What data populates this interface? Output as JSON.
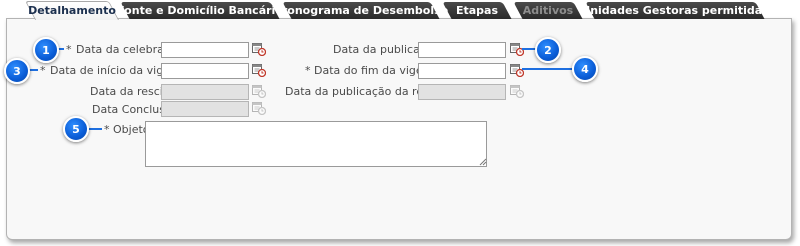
{
  "tabs": [
    {
      "label": "Detalhamento",
      "state": "active"
    },
    {
      "label": "Fonte e Domicílio Bancário",
      "state": "normal"
    },
    {
      "label": "Cronograma de Desembolso",
      "state": "normal"
    },
    {
      "label": "Etapas",
      "state": "normal"
    },
    {
      "label": "Aditivos",
      "state": "disabled"
    },
    {
      "label": "Unidades Gestoras permitidas",
      "state": "normal"
    }
  ],
  "form": {
    "data_celebracao": {
      "required_mark": "*",
      "label": "Data da celebração",
      "value": ""
    },
    "data_publicacao": {
      "label": "Data da publicação",
      "value": ""
    },
    "data_inicio_vigencia": {
      "required_mark": "*",
      "label": "Data de início da vigência",
      "value": ""
    },
    "data_fim_vigencia": {
      "required_mark": "*",
      "label": "Data do fim da vigência",
      "value": ""
    },
    "data_rescisao": {
      "label": "Data da rescisão",
      "value": ""
    },
    "data_publicacao_rescisao": {
      "label": "Data da publicação da rescisão",
      "value": ""
    },
    "data_conclusao": {
      "label": "Data Conclusão",
      "value": ""
    },
    "objeto": {
      "required_mark": "*",
      "label": "Objeto",
      "value": ""
    }
  },
  "callouts": [
    "1",
    "2",
    "3",
    "4",
    "5"
  ],
  "colors": {
    "accent": "#1e6fe0",
    "tab_dark": "#3a3a3a",
    "active_tab_text": "#1b2f4e",
    "panel_bg": "#f8f8f8"
  },
  "icons": {
    "calendar": "calendar-clock-icon"
  }
}
